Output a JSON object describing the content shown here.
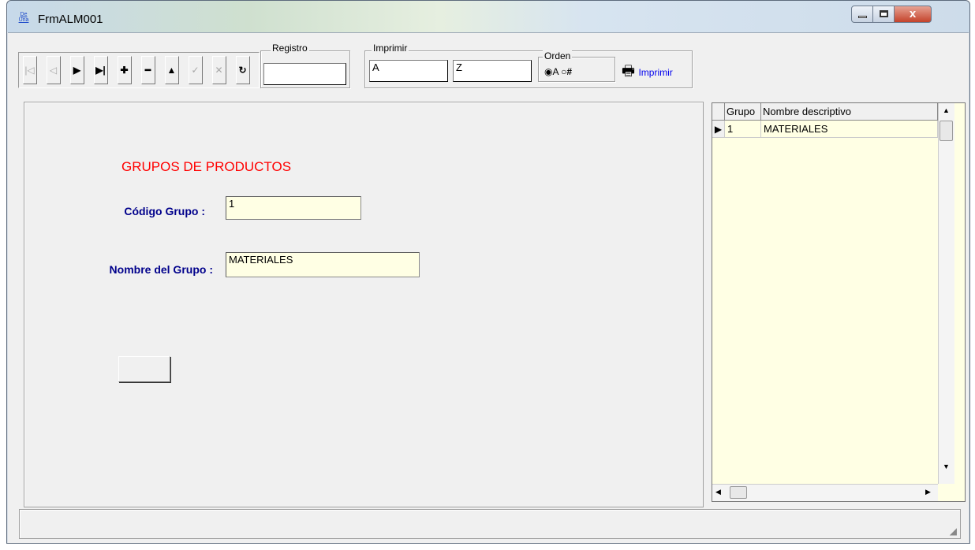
{
  "window": {
    "title": "FrmALM001",
    "app_icon_text": "De Una",
    "close_glyph": "x"
  },
  "toolbar": {
    "nav_buttons": [
      {
        "name": "first-record-button",
        "glyph": "|◁",
        "enabled": false
      },
      {
        "name": "previous-record-button",
        "glyph": "◁",
        "enabled": false
      },
      {
        "name": "next-record-button",
        "glyph": "▶",
        "enabled": true
      },
      {
        "name": "last-record-button",
        "glyph": "▶|",
        "enabled": true
      },
      {
        "name": "add-record-button",
        "glyph": "✚",
        "enabled": true
      },
      {
        "name": "delete-record-button",
        "glyph": "━",
        "enabled": true
      },
      {
        "name": "edit-record-button",
        "glyph": "▲",
        "enabled": true
      },
      {
        "name": "save-record-button",
        "glyph": "✓",
        "enabled": false
      },
      {
        "name": "cancel-edit-button",
        "glyph": "✕",
        "enabled": false
      },
      {
        "name": "refresh-button",
        "glyph": "↻",
        "enabled": true
      }
    ],
    "registro": {
      "label": "Registro",
      "value": ""
    },
    "imprimir": {
      "label": "Imprimir",
      "from": "A",
      "to": "Z"
    },
    "orden": {
      "label": "Orden",
      "option_alpha": "A",
      "option_num": "#",
      "selected": "A"
    },
    "print_button": {
      "label": "Imprimir"
    }
  },
  "form": {
    "heading": "GRUPOS DE PRODUCTOS",
    "codigo_label": "Código Grupo",
    "codigo_value": "1",
    "nombre_label": "Nombre del Grupo",
    "nombre_value": "MATERIALES",
    "label_separator": ":"
  },
  "grid": {
    "columns": [
      "Grupo",
      "Nombre descriptivo"
    ],
    "rows": [
      [
        "1",
        "MATERIALES"
      ]
    ]
  },
  "colors": {
    "heading": "#ff0000",
    "label": "#00008b",
    "field_background": "#ffffe4"
  }
}
